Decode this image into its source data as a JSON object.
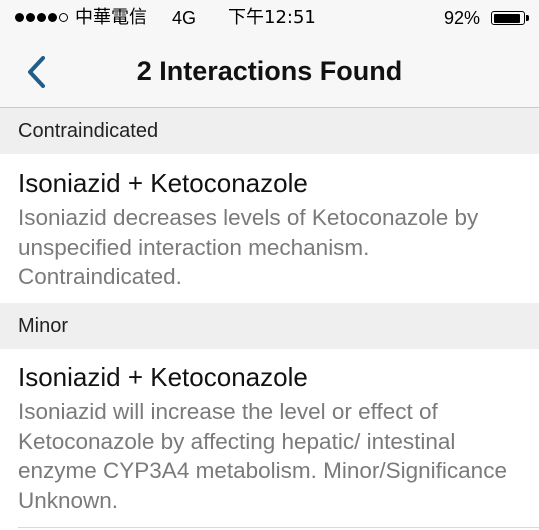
{
  "status_bar": {
    "carrier": "中華電信",
    "network": "4G",
    "time": "下午12:51",
    "battery_percent": "92%",
    "battery_level": 0.92
  },
  "nav": {
    "title": "2 Interactions Found",
    "back_icon": "chevron-left-icon",
    "accent_color": "#1f5d8a"
  },
  "sections": [
    {
      "header": "Contraindicated",
      "interaction": {
        "title": "Isoniazid + Ketoconazole",
        "description": "Isoniazid decreases levels of Ketoconazole by unspecified interaction mechanism. Contraindicated."
      }
    },
    {
      "header": "Minor",
      "interaction": {
        "title": "Isoniazid + Ketoconazole",
        "description": "Isoniazid will increase the level or effect of Ketoconazole by affecting hepatic/ intestinal enzyme CYP3A4 metabolism. Minor/Significance Unknown."
      }
    }
  ]
}
